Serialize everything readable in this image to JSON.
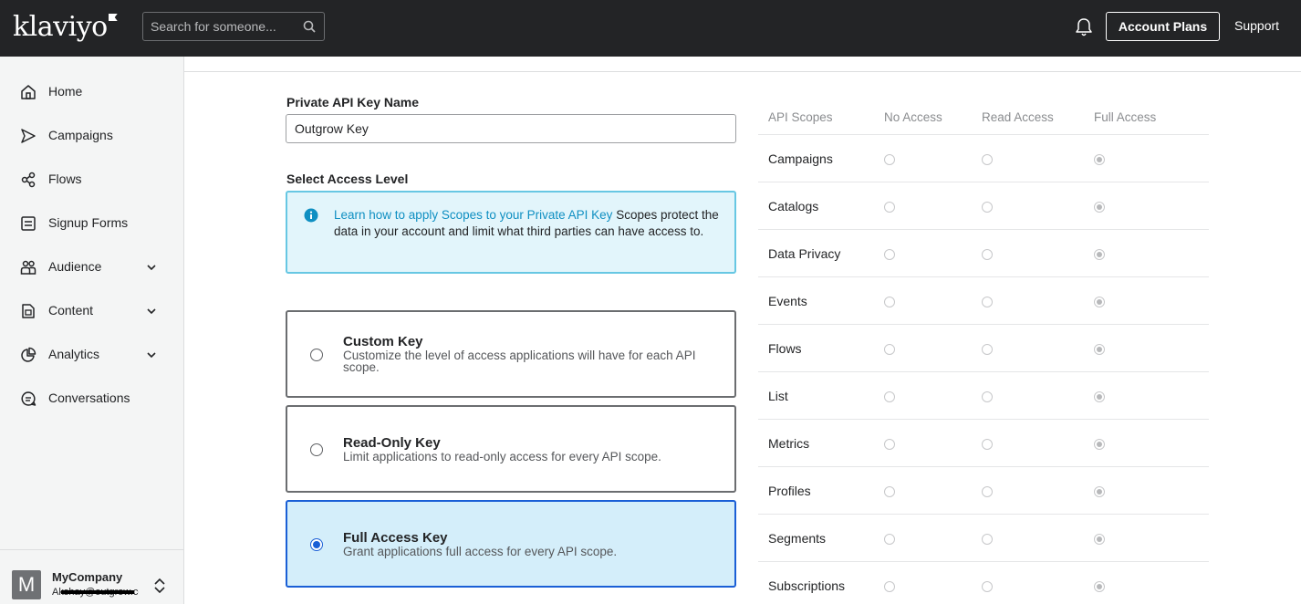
{
  "topbar": {
    "logo_text": "klaviyo",
    "search_placeholder": "Search for someone...",
    "account_plans_label": "Account Plans",
    "support_label": "Support"
  },
  "sidebar": {
    "items": [
      {
        "label": "Home",
        "icon": "home-icon",
        "has_chevron": false
      },
      {
        "label": "Campaigns",
        "icon": "send-icon",
        "has_chevron": false
      },
      {
        "label": "Flows",
        "icon": "flows-icon",
        "has_chevron": false
      },
      {
        "label": "Signup Forms",
        "icon": "form-icon",
        "has_chevron": false
      },
      {
        "label": "Audience",
        "icon": "people-icon",
        "has_chevron": true
      },
      {
        "label": "Content",
        "icon": "content-icon",
        "has_chevron": true
      },
      {
        "label": "Analytics",
        "icon": "pie-chart-icon",
        "has_chevron": true
      },
      {
        "label": "Conversations",
        "icon": "chat-icon",
        "has_chevron": false
      }
    ],
    "account": {
      "avatar_letter": "M",
      "company": "MyCompany",
      "email": "Akshay@outgrow.co"
    }
  },
  "form": {
    "key_name_label": "Private API Key Name",
    "key_name_value": "Outgrow Key",
    "access_level_label": "Select Access Level",
    "info": {
      "link_text": "Learn how to apply Scopes to your Private API Key",
      "text": " Scopes protect the data in your account and limit what third parties can have access to."
    },
    "key_types": [
      {
        "title": "Custom Key",
        "description": "Customize the level of access applications will have for each API scope.",
        "selected": false
      },
      {
        "title": "Read-Only Key",
        "description": "Limit applications to read-only access for every API scope.",
        "selected": false
      },
      {
        "title": "Full Access Key",
        "description": "Grant applications full access for every API scope.",
        "selected": true
      }
    ]
  },
  "scopes": {
    "headers": [
      "API Scopes",
      "No Access",
      "Read Access",
      "Full Access"
    ],
    "rows": [
      {
        "name": "Campaigns",
        "level": "Full Access"
      },
      {
        "name": "Catalogs",
        "level": "Full Access"
      },
      {
        "name": "Data Privacy",
        "level": "Full Access"
      },
      {
        "name": "Events",
        "level": "Full Access"
      },
      {
        "name": "Flows",
        "level": "Full Access"
      },
      {
        "name": "List",
        "level": "Full Access"
      },
      {
        "name": "Metrics",
        "level": "Full Access"
      },
      {
        "name": "Profiles",
        "level": "Full Access"
      },
      {
        "name": "Segments",
        "level": "Full Access"
      },
      {
        "name": "Subscriptions",
        "level": "Full Access"
      }
    ]
  }
}
